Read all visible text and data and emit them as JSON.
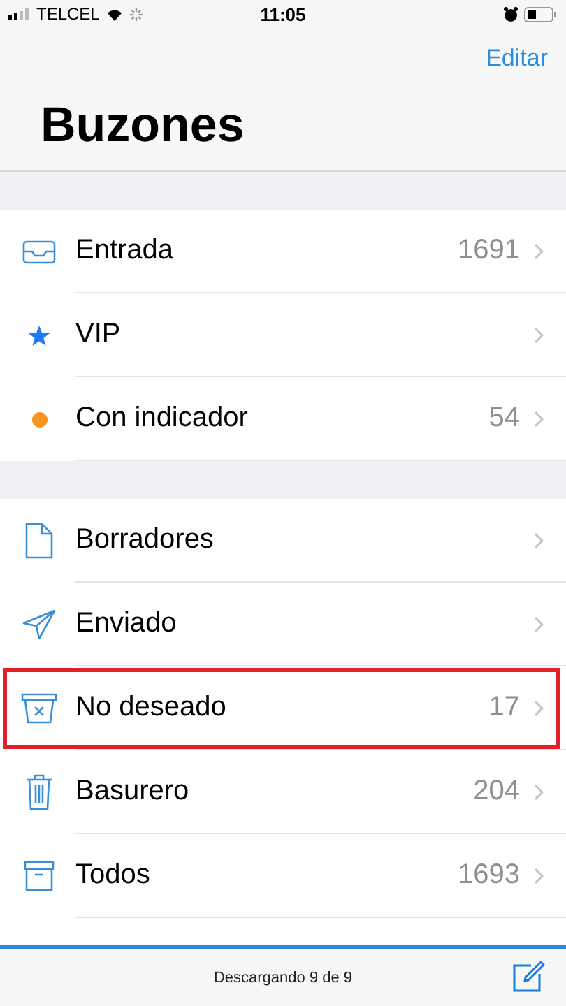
{
  "status_bar": {
    "carrier": "TELCEL",
    "time": "11:05"
  },
  "nav": {
    "edit": "Editar",
    "title": "Buzones"
  },
  "groups": [
    {
      "items": [
        {
          "kind": "inbox",
          "label": "Entrada",
          "count": "1691",
          "highlighted": false
        },
        {
          "kind": "star",
          "label": "VIP",
          "highlighted": false
        },
        {
          "kind": "dot",
          "label": "Con indicador",
          "count": "54",
          "color": "#f7961e",
          "highlighted": false
        }
      ]
    },
    {
      "items": [
        {
          "kind": "draft",
          "label": "Borradores",
          "highlighted": false
        },
        {
          "kind": "sent",
          "label": "Enviado",
          "highlighted": false
        },
        {
          "kind": "junk",
          "label": "No deseado",
          "count": "17",
          "highlighted": true
        },
        {
          "kind": "trash",
          "label": "Basurero",
          "count": "204",
          "highlighted": false
        },
        {
          "kind": "archive",
          "label": "Todos",
          "count": "1693",
          "highlighted": false
        }
      ]
    }
  ],
  "toolbar": {
    "status": "Descargando 9 de 9",
    "progress": {
      "level": 1
    }
  }
}
